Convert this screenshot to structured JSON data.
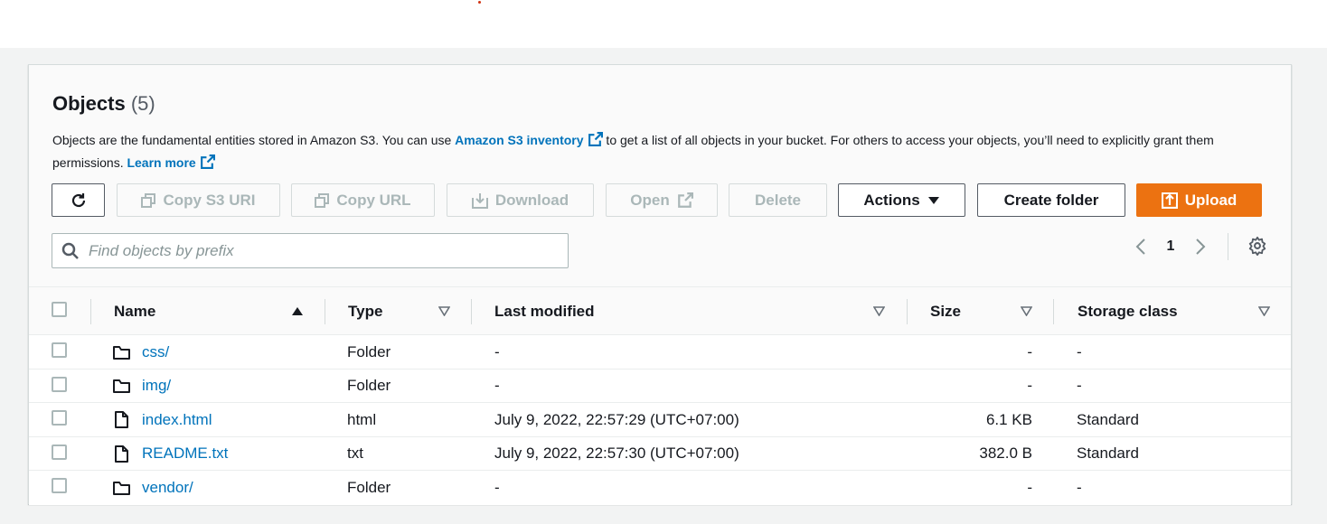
{
  "header": {
    "title": "Objects",
    "count": "(5)"
  },
  "description": {
    "text1": "Objects are the fundamental entities stored in Amazon S3. You can use ",
    "inventory_link": "Amazon S3 inventory",
    "text2": " to get a list of all objects in your bucket. For others to access your objects, you’ll need to explicitly grant them permissions. ",
    "learn_more": "Learn more"
  },
  "toolbar": {
    "copy_s3_uri": "Copy S3 URI",
    "copy_url": "Copy URL",
    "download": "Download",
    "open": "Open",
    "delete": "Delete",
    "actions": "Actions",
    "create_folder": "Create folder",
    "upload": "Upload"
  },
  "search": {
    "placeholder": "Find objects by prefix"
  },
  "pagination": {
    "current_page": "1"
  },
  "table": {
    "columns": {
      "name": "Name",
      "type": "Type",
      "last_modified": "Last modified",
      "size": "Size",
      "storage_class": "Storage class"
    },
    "rows": [
      {
        "name": "css/",
        "icon": "folder-icon",
        "type": "Folder",
        "last_modified": "-",
        "size": "-",
        "storage_class": "-"
      },
      {
        "name": "img/",
        "icon": "folder-icon",
        "type": "Folder",
        "last_modified": "-",
        "size": "-",
        "storage_class": "-"
      },
      {
        "name": "index.html",
        "icon": "file-icon",
        "type": "html",
        "last_modified": "July 9, 2022, 22:57:29 (UTC+07:00)",
        "size": "6.1 KB",
        "storage_class": "Standard"
      },
      {
        "name": "README.txt",
        "icon": "file-icon",
        "type": "txt",
        "last_modified": "July 9, 2022, 22:57:30 (UTC+07:00)",
        "size": "382.0 B",
        "storage_class": "Standard"
      },
      {
        "name": "vendor/",
        "icon": "folder-icon",
        "type": "Folder",
        "last_modified": "-",
        "size": "-",
        "storage_class": "-"
      }
    ]
  },
  "colors": {
    "accent": "#ec7211",
    "link": "#0073bb",
    "text": "#16191f",
    "disabled": "#aab7b8"
  }
}
